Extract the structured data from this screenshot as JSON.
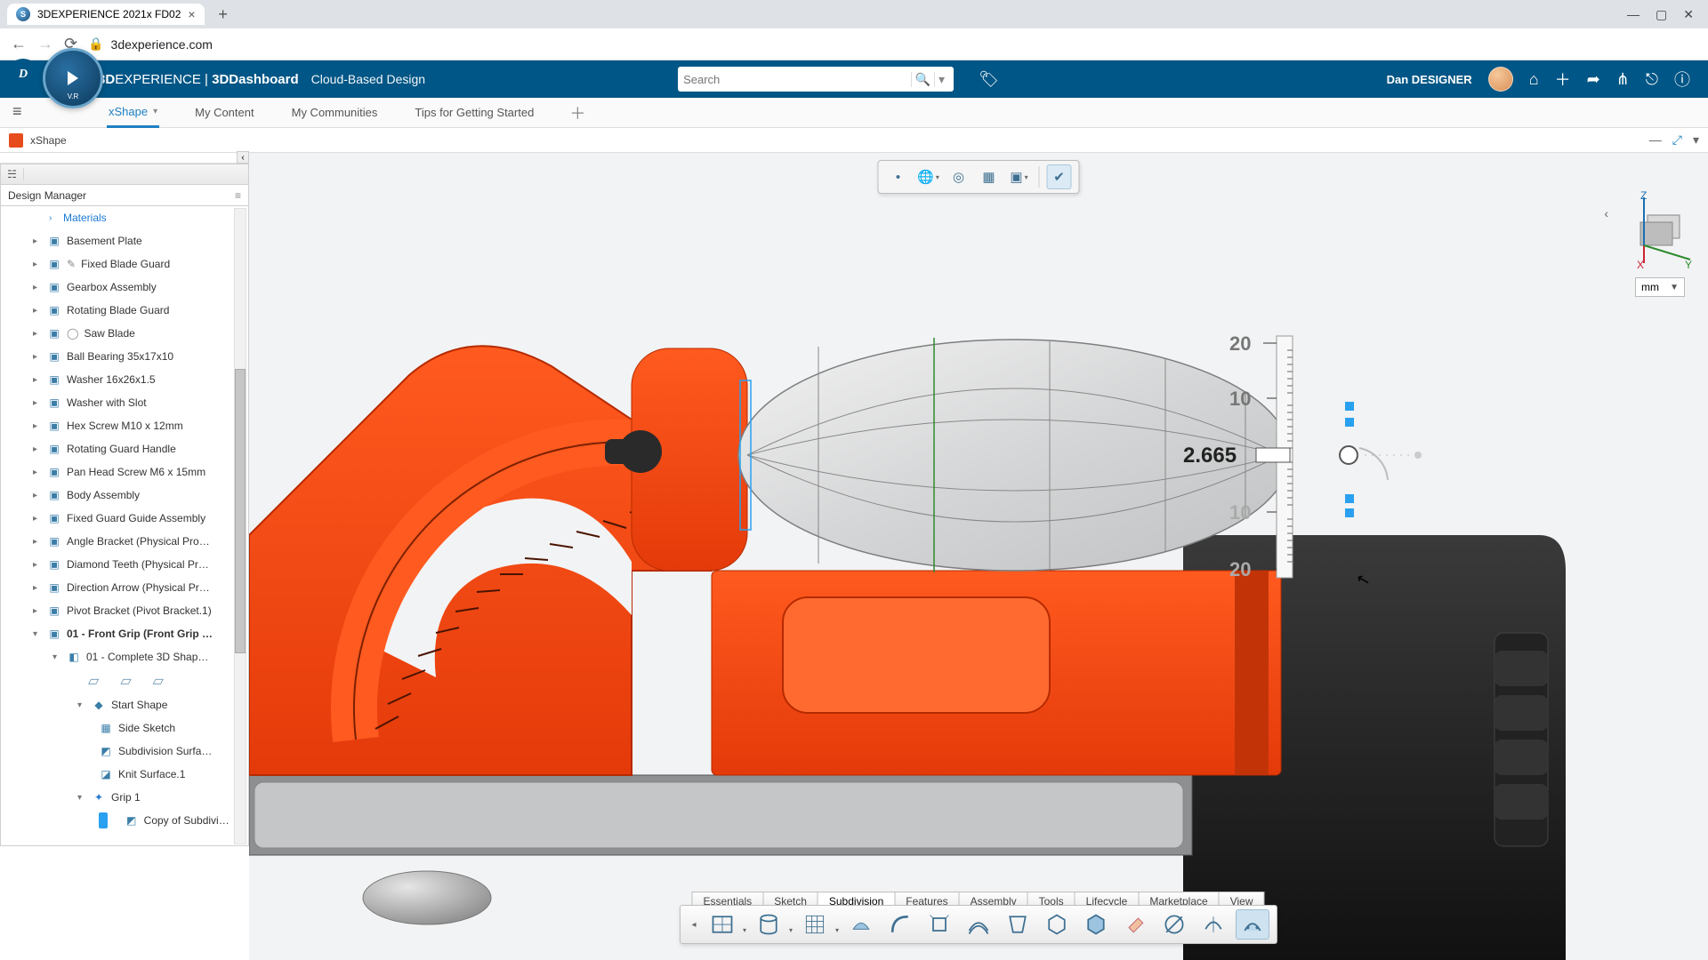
{
  "browser": {
    "tab_title": "3DEXPERIENCE 2021x FD02",
    "url": "3dexperience.com"
  },
  "header": {
    "brand_b": "3D",
    "brand_rest": "EXPERIENCE",
    "sep": " | ",
    "dashboard": "3DDashboard",
    "subtitle": "Cloud-Based Design",
    "search_placeholder": "Search",
    "user": "Dan DESIGNER",
    "compass_label": "V.R"
  },
  "dash_tabs": {
    "items": [
      "xShape",
      "My Content",
      "My Communities",
      "Tips for Getting Started"
    ],
    "active": 0
  },
  "panel": {
    "title": "xShape"
  },
  "design_manager": {
    "title": "Design Manager",
    "materials": "Materials",
    "nodes": [
      "Basement Plate",
      "Fixed Blade Guard",
      "Gearbox Assembly",
      "Rotating Blade Guard",
      "Saw Blade",
      "Ball Bearing 35x17x10",
      "Washer 16x26x1.5",
      "Washer with Slot",
      "Hex Screw M10 x 12mm",
      "Rotating Guard Handle",
      "Pan Head Screw M6 x 15mm",
      "Body Assembly",
      "Fixed Guard Guide Assembly",
      "Angle Bracket (Physical Pro…",
      "Diamond Teeth (Physical Pr…",
      "Direction Arrow (Physical Pr…",
      "Pivot Bracket (Pivot Bracket.1)"
    ],
    "front_grip": "01 - Front Grip (Front Grip …",
    "complete_shape": "01 - Complete 3D Shap…",
    "start_shape": "Start Shape",
    "side_sketch": "Side Sketch",
    "sub_surf": "Subdivision Surfa…",
    "knit": "Knit Surface.1",
    "grip": "Grip 1",
    "copy": "Copy of Subdivi…"
  },
  "viewport": {
    "ruler": {
      "t20": "20",
      "t10": "10",
      "b10": "10",
      "b20": "20"
    },
    "measure_value": "2.665",
    "axes": {
      "z": "Z",
      "x": "X",
      "y": "Y"
    },
    "unit": "mm"
  },
  "bottom_tabs": [
    "Essentials",
    "Sketch",
    "Subdivision",
    "Features",
    "Assembly",
    "Tools",
    "Lifecycle",
    "Marketplace",
    "View"
  ],
  "bottom_tabs_active": 2
}
